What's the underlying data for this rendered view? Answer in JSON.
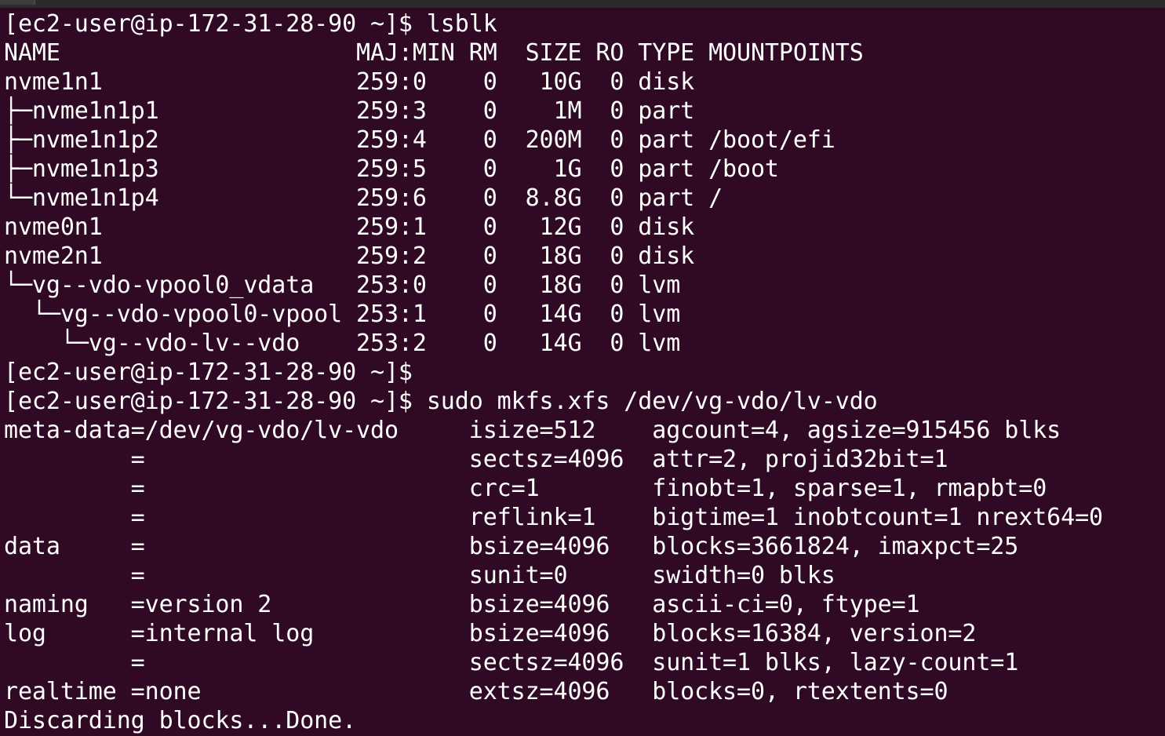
{
  "terminal": {
    "background": "#300a24",
    "foreground": "#ffffff",
    "lines": [
      "[ec2-user@ip-172-31-28-90 ~]$ lsblk",
      "NAME                     MAJ:MIN RM  SIZE RO TYPE MOUNTPOINTS",
      "nvme1n1                  259:0    0   10G  0 disk",
      "├─nvme1n1p1              259:3    0    1M  0 part",
      "├─nvme1n1p2              259:4    0  200M  0 part /boot/efi",
      "├─nvme1n1p3              259:5    0    1G  0 part /boot",
      "└─nvme1n1p4              259:6    0  8.8G  0 part /",
      "nvme0n1                  259:1    0   12G  0 disk",
      "nvme2n1                  259:2    0   18G  0 disk",
      "└─vg--vdo-vpool0_vdata   253:0    0   18G  0 lvm",
      "  └─vg--vdo-vpool0-vpool 253:1    0   14G  0 lvm",
      "    └─vg--vdo-lv--vdo    253:2    0   14G  0 lvm",
      "[ec2-user@ip-172-31-28-90 ~]$",
      "[ec2-user@ip-172-31-28-90 ~]$ sudo mkfs.xfs /dev/vg-vdo/lv-vdo",
      "meta-data=/dev/vg-vdo/lv-vdo     isize=512    agcount=4, agsize=915456 blks",
      "         =                       sectsz=4096  attr=2, projid32bit=1",
      "         =                       crc=1        finobt=1, sparse=1, rmapbt=0",
      "         =                       reflink=1    bigtime=1 inobtcount=1 nrext64=0",
      "data     =                       bsize=4096   blocks=3661824, imaxpct=25",
      "         =                       sunit=0      swidth=0 blks",
      "naming   =version 2              bsize=4096   ascii-ci=0, ftype=1",
      "log      =internal log           bsize=4096   blocks=16384, version=2",
      "         =                       sectsz=4096  sunit=1 blks, lazy-count=1",
      "realtime =none                   extsz=4096   blocks=0, rtextents=0",
      "Discarding blocks...Done."
    ]
  }
}
